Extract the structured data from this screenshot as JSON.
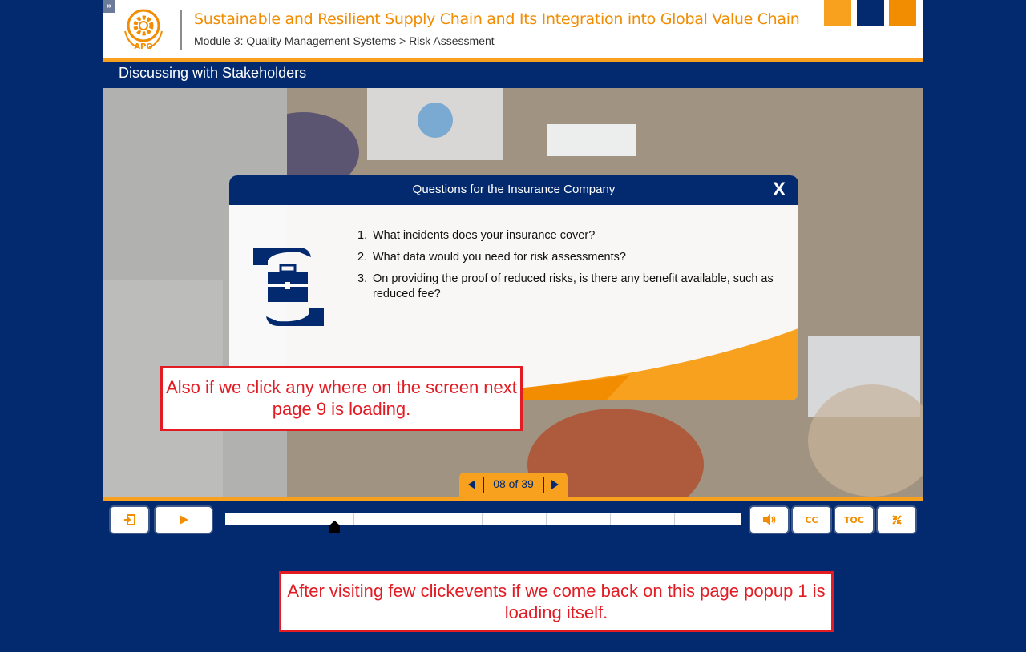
{
  "header": {
    "course_title": "Sustainable and Resilient Supply Chain and Its Integration into Global Value Chain",
    "breadcrumb": "Module 3: Quality Management Systems > Risk Assessment",
    "logo_text": "APO",
    "square_colors": [
      "#f8a11e",
      "#032a6e",
      "#f28c00"
    ]
  },
  "slide": {
    "title": "Discussing with Stakeholders"
  },
  "popup": {
    "title": "Questions for the Insurance Company",
    "close_label": "X",
    "questions": [
      {
        "num": "1.",
        "text": "What incidents does your insurance cover?"
      },
      {
        "num": "2.",
        "text": "What data would you need for risk assessments?"
      },
      {
        "num": "3.",
        "text": "On providing the proof of reduced risks, is there any benefit available, such as reduced fee?"
      }
    ]
  },
  "annotations": {
    "note1": "Also if we click any where on the screen next page 9 is loading.",
    "note2": "After visiting few clickevents if we come back on this page popup 1 is loading itself."
  },
  "pager": {
    "label": "08 of 39"
  },
  "controls": {
    "cc_label": "CC",
    "toc_label": "TOC"
  },
  "progress": {
    "value_fraction": 0.21
  },
  "colors": {
    "navy": "#032a6e",
    "orange": "#f8a11e",
    "dark_orange": "#f28c00",
    "annotation_red": "#e31b23"
  }
}
